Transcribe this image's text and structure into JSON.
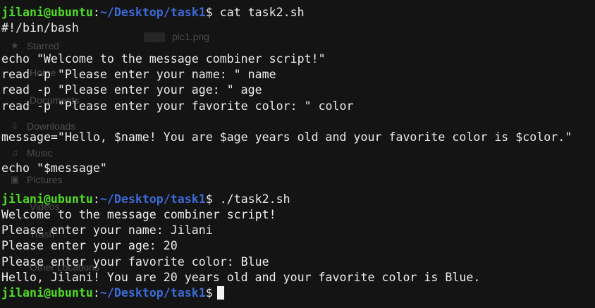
{
  "prompt": {
    "user_host": "jilani@ubuntu",
    "separator": ":",
    "path": "~/Desktop/task1",
    "symbol": "$"
  },
  "commands": {
    "cat": "cat task2.sh",
    "run": "./task2.sh"
  },
  "script_lines": [
    "#!/bin/bash",
    "",
    "echo \"Welcome to the message combiner script!\"",
    "read -p \"Please enter your name: \" name",
    "read -p \"Please enter your age: \" age",
    "read -p \"Please enter your favorite color: \" color",
    "",
    "message=\"Hello, $name! You are $age years old and your favorite color is $color.\"",
    "",
    "echo \"$message\""
  ],
  "output_lines": [
    "Welcome to the message combiner script!",
    "Please enter your name: Jilani",
    "Please enter your age: 20",
    "Please enter your favorite color: Blue",
    "Hello, Jilani! You are 20 years old and your favorite color is Blue."
  ],
  "background_sidebar": {
    "file_name": "pic1.png",
    "items": [
      "Starred",
      "Home",
      "Documents",
      "Downloads",
      "Music",
      "Pictures",
      "Videos",
      "Trash",
      "Other Locations"
    ]
  }
}
